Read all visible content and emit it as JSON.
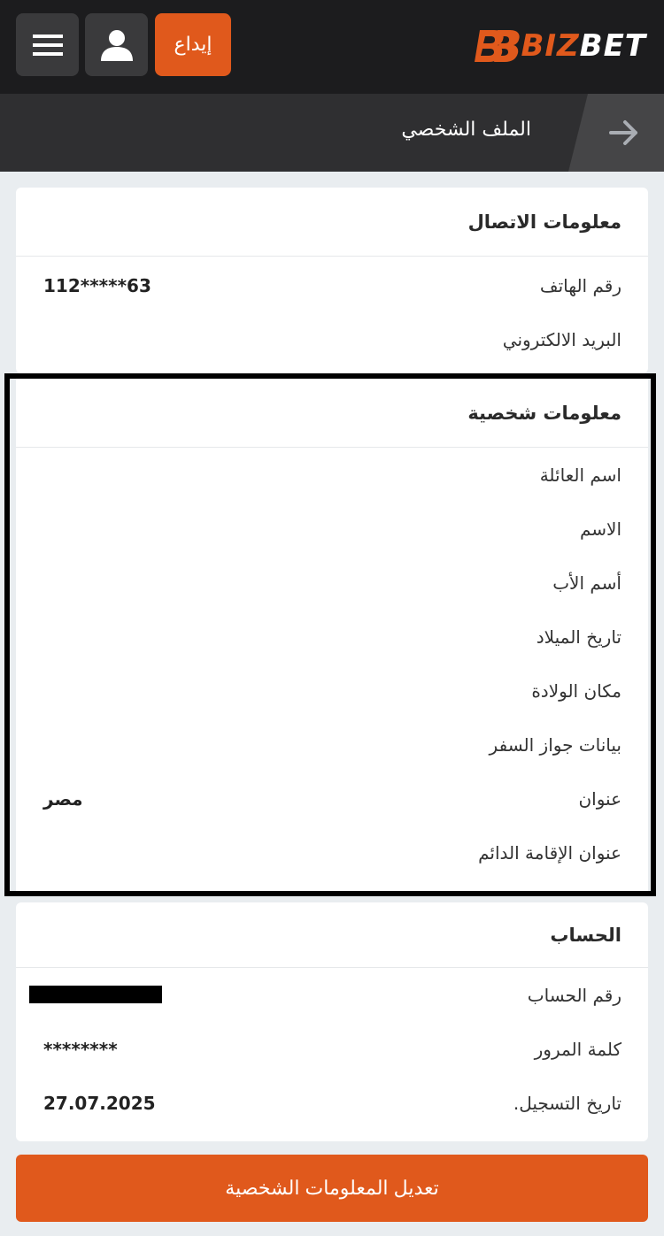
{
  "header": {
    "deposit_label": "إيداع",
    "logo": {
      "b": "BB",
      "biz": "BIZ",
      "bet": "BET"
    },
    "menu_icon": "hamburger-icon",
    "user_icon": "user-icon"
  },
  "subheader": {
    "title": "الملف الشخصي",
    "back_icon": "arrow-right-icon"
  },
  "contact": {
    "title": "معلومات الاتصال",
    "rows": [
      {
        "label": "رقم الهاتف",
        "value": "112*****63"
      },
      {
        "label": "البريد الالكتروني",
        "value": ""
      }
    ]
  },
  "personal": {
    "title": "معلومات شخصية",
    "rows": [
      {
        "label": "اسم العائلة",
        "value": ""
      },
      {
        "label": "الاسم",
        "value": ""
      },
      {
        "label": "أسم الأب",
        "value": ""
      },
      {
        "label": "تاريخ الميلاد",
        "value": ""
      },
      {
        "label": "مكان الولادة",
        "value": ""
      },
      {
        "label": "بيانات جواز السفر",
        "value": ""
      },
      {
        "label": "عنوان",
        "value": "مصر"
      },
      {
        "label": "عنوان الإقامة الدائم",
        "value": ""
      }
    ]
  },
  "account": {
    "title": "الحساب",
    "rows": [
      {
        "label": "رقم الحساب",
        "value": ""
      },
      {
        "label": "كلمة المرور",
        "value": "********"
      },
      {
        "label": "تاريخ التسجيل.",
        "value": "27.07.2025"
      }
    ]
  },
  "edit_button_label": "تعديل المعلومات الشخصية",
  "colors": {
    "accent": "#e0591c",
    "topbar": "#1c1c1e",
    "subheader": "#2f2f31"
  }
}
